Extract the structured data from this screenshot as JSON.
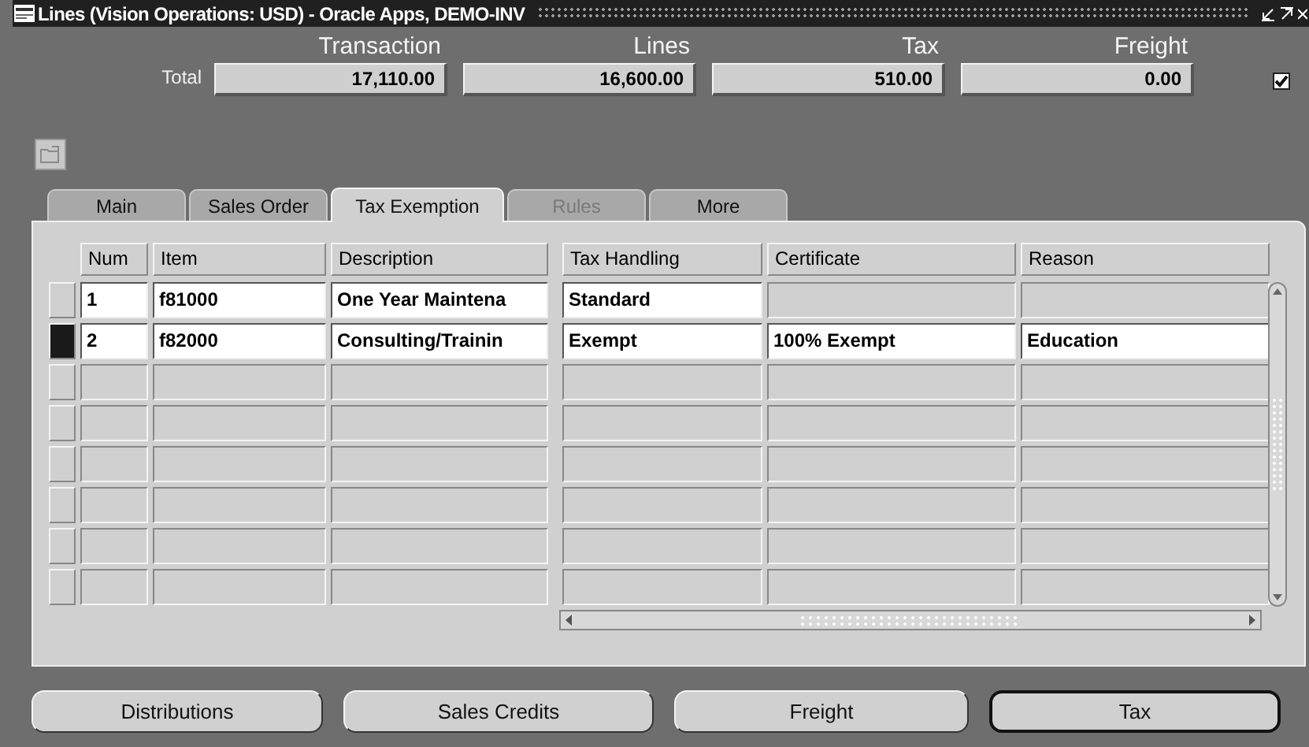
{
  "window": {
    "title": "Lines (Vision Operations: USD) - Oracle Apps, DEMO-INV"
  },
  "totals": {
    "label": "Total",
    "fields": [
      {
        "heading": "Transaction",
        "value": "17,110.00"
      },
      {
        "heading": "Lines",
        "value": "16,600.00"
      },
      {
        "heading": "Tax",
        "value": "510.00"
      },
      {
        "heading": "Freight",
        "value": "0.00"
      }
    ],
    "checked": true
  },
  "tabs": [
    {
      "label": "Main",
      "selected": false,
      "disabled": false
    },
    {
      "label": "Sales Order",
      "selected": false,
      "disabled": false
    },
    {
      "label": "Tax Exemption",
      "selected": true,
      "disabled": false
    },
    {
      "label": "Rules",
      "selected": false,
      "disabled": true
    },
    {
      "label": "More",
      "selected": false,
      "disabled": false
    }
  ],
  "table": {
    "columns": [
      "Num",
      "Item",
      "Description",
      "Tax Handling",
      "Certificate",
      "Reason"
    ],
    "rows": [
      {
        "selected": false,
        "cells": [
          "1",
          "f81000",
          "One Year Maintena",
          "Standard",
          null,
          null
        ]
      },
      {
        "selected": true,
        "cells": [
          "2",
          "f82000",
          "Consulting/Trainin",
          "Exempt",
          "100% Exempt",
          "Education"
        ]
      }
    ]
  },
  "buttons": [
    {
      "label": "Distributions",
      "default": false
    },
    {
      "label": "Sales Credits",
      "default": false
    },
    {
      "label": "Freight",
      "default": false
    },
    {
      "label": "Tax",
      "default": true
    }
  ]
}
